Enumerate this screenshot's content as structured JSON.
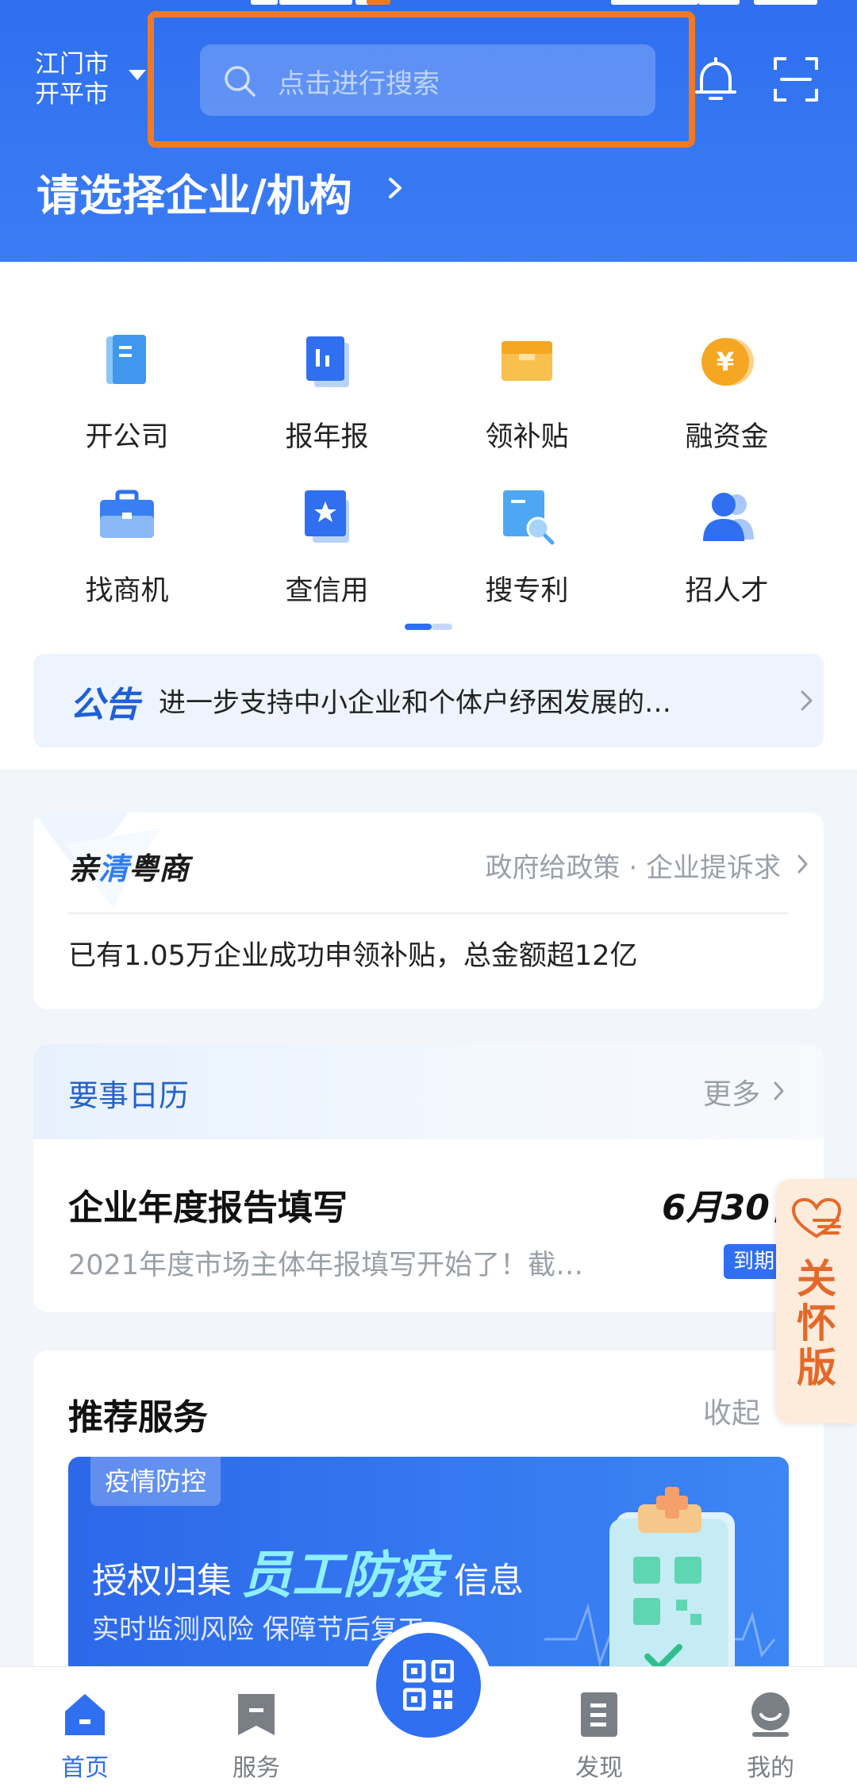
{
  "header": {
    "city_line1": "江门市",
    "city_line2": "开平市",
    "search_placeholder": "点击进行搜索",
    "company_select": "请选择企业/机构"
  },
  "grid": {
    "items": [
      {
        "label": "开公司",
        "icon": "company-doc-icon"
      },
      {
        "label": "报年报",
        "icon": "annual-report-icon"
      },
      {
        "label": "领补贴",
        "icon": "subsidy-box-icon"
      },
      {
        "label": "融资金",
        "icon": "yen-coin-icon"
      },
      {
        "label": "找商机",
        "icon": "briefcase-icon"
      },
      {
        "label": "查信用",
        "icon": "credit-star-icon"
      },
      {
        "label": "搜专利",
        "icon": "patent-search-icon"
      },
      {
        "label": "招人才",
        "icon": "talent-users-icon"
      }
    ]
  },
  "notice": {
    "tag": "公告",
    "text": "进一步支持中小企业和个体户纾困发展的…"
  },
  "qinqing": {
    "title_pre": "亲",
    "title_accent": "清",
    "title_post": "粤商",
    "links": "政府给政策 · 企业提诉求",
    "text": "已有1.05万企业成功申领补贴，总金额超12亿"
  },
  "calendar": {
    "title": "要事日历",
    "more": "更多",
    "item_title": "企业年度报告填写",
    "item_date": "6月30日",
    "item_desc": "2021年度市场主体年报填写开始了！截…",
    "badge": "到期"
  },
  "recommend": {
    "title": "推荐服务",
    "collapse": "收起",
    "banner_tag": "疫情防控",
    "banner_pre": "授权归集",
    "banner_em": "员工防疫",
    "banner_post": "信息",
    "banner_sub": "实时监测风险 保障节后复工"
  },
  "care_mode": {
    "label": "关怀版"
  },
  "bottom_nav": {
    "items": [
      {
        "label": "首页",
        "icon": "home-icon"
      },
      {
        "label": "服务",
        "icon": "service-bookmark-icon"
      },
      {
        "label": "发现",
        "icon": "discover-doc-icon"
      },
      {
        "label": "我的",
        "icon": "profile-icon"
      }
    ],
    "center_icon": "qr-code-icon"
  },
  "colors": {
    "primary": "#2f6ff0",
    "search_highlight": "#f07a24",
    "care_orange": "#e3692a"
  }
}
